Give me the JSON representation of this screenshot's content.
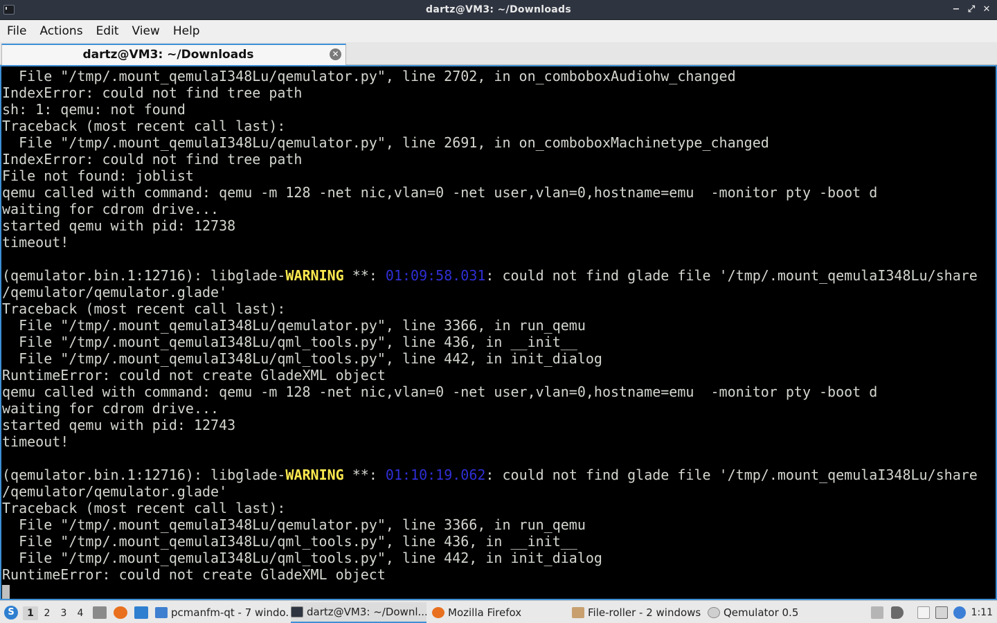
{
  "window": {
    "title": "dartz@VM3: ~/Downloads",
    "buttons": {
      "minimize": "−",
      "maximize": "⤢",
      "close": "✕"
    }
  },
  "menu": [
    "File",
    "Actions",
    "Edit",
    "View",
    "Help"
  ],
  "tab": {
    "label": "dartz@VM3: ~/Downloads",
    "close": "✕"
  },
  "terminal": {
    "lines": [
      {
        "t": "  File \"/tmp/.mount_qemulaI348Lu/qemulator.py\", line 2702, in on_comboboxAudiohw_changed"
      },
      {
        "t": "IndexError: could not find tree path"
      },
      {
        "t": "sh: 1: qemu: not found"
      },
      {
        "t": "Traceback (most recent call last):"
      },
      {
        "t": "  File \"/tmp/.mount_qemulaI348Lu/qemulator.py\", line 2691, in on_comboboxMachinetype_changed"
      },
      {
        "t": "IndexError: could not find tree path"
      },
      {
        "t": "File not found: joblist"
      },
      {
        "t": "qemu called with command: qemu -m 128 -net nic,vlan=0 -net user,vlan=0,hostname=emu  -monitor pty -boot d"
      },
      {
        "t": "waiting for cdrom drive..."
      },
      {
        "t": "started qemu with pid: 12738"
      },
      {
        "t": "timeout!"
      },
      {
        "t": ""
      },
      {
        "pre": "(qemulator.bin.1:12716): libglade-",
        "warn": "WARNING",
        "mid": " **: ",
        "ts": "01:09:58.031",
        "post": ": could not find glade file '/tmp/.mount_qemulaI348Lu/share"
      },
      {
        "t": "/qemulator/qemulator.glade'"
      },
      {
        "t": "Traceback (most recent call last):"
      },
      {
        "t": "  File \"/tmp/.mount_qemulaI348Lu/qemulator.py\", line 3366, in run_qemu"
      },
      {
        "t": "  File \"/tmp/.mount_qemulaI348Lu/qml_tools.py\", line 436, in __init__"
      },
      {
        "t": "  File \"/tmp/.mount_qemulaI348Lu/qml_tools.py\", line 442, in init_dialog"
      },
      {
        "t": "RuntimeError: could not create GladeXML object"
      },
      {
        "t": "qemu called with command: qemu -m 128 -net nic,vlan=0 -net user,vlan=0,hostname=emu  -monitor pty -boot d"
      },
      {
        "t": "waiting for cdrom drive..."
      },
      {
        "t": "started qemu with pid: 12743"
      },
      {
        "t": "timeout!"
      },
      {
        "t": ""
      },
      {
        "pre": "(qemulator.bin.1:12716): libglade-",
        "warn": "WARNING",
        "mid": " **: ",
        "ts": "01:10:19.062",
        "post": ": could not find glade file '/tmp/.mount_qemulaI348Lu/share"
      },
      {
        "t": "/qemulator/qemulator.glade'"
      },
      {
        "t": "Traceback (most recent call last):"
      },
      {
        "t": "  File \"/tmp/.mount_qemulaI348Lu/qemulator.py\", line 3366, in run_qemu"
      },
      {
        "t": "  File \"/tmp/.mount_qemulaI348Lu/qml_tools.py\", line 436, in __init__"
      },
      {
        "t": "  File \"/tmp/.mount_qemulaI348Lu/qml_tools.py\", line 442, in init_dialog"
      },
      {
        "t": "RuntimeError: could not create GladeXML object"
      }
    ]
  },
  "taskbar": {
    "desktops": [
      "1",
      "2",
      "3",
      "4"
    ],
    "active_desktop": "1",
    "tasks": [
      {
        "label": "pcmanfm-qt - 7 windo...",
        "icon": "folder-icon"
      },
      {
        "label": "dartz@VM3: ~/Downl...",
        "icon": "terminal-icon"
      },
      {
        "label": "Mozilla Firefox",
        "icon": "firefox-icon"
      },
      {
        "label": "File-roller - 2 windows",
        "icon": "archive-icon"
      },
      {
        "label": "Qemulator 0.5",
        "icon": "qemulator-icon"
      }
    ],
    "clock": "1:11"
  },
  "colors": {
    "terminal_bg": "#000000",
    "terminal_fg": "#d3d7cf",
    "warning": "#fce94f",
    "timestamp": "#2f2fd6",
    "accent": "#3d8fd6"
  }
}
